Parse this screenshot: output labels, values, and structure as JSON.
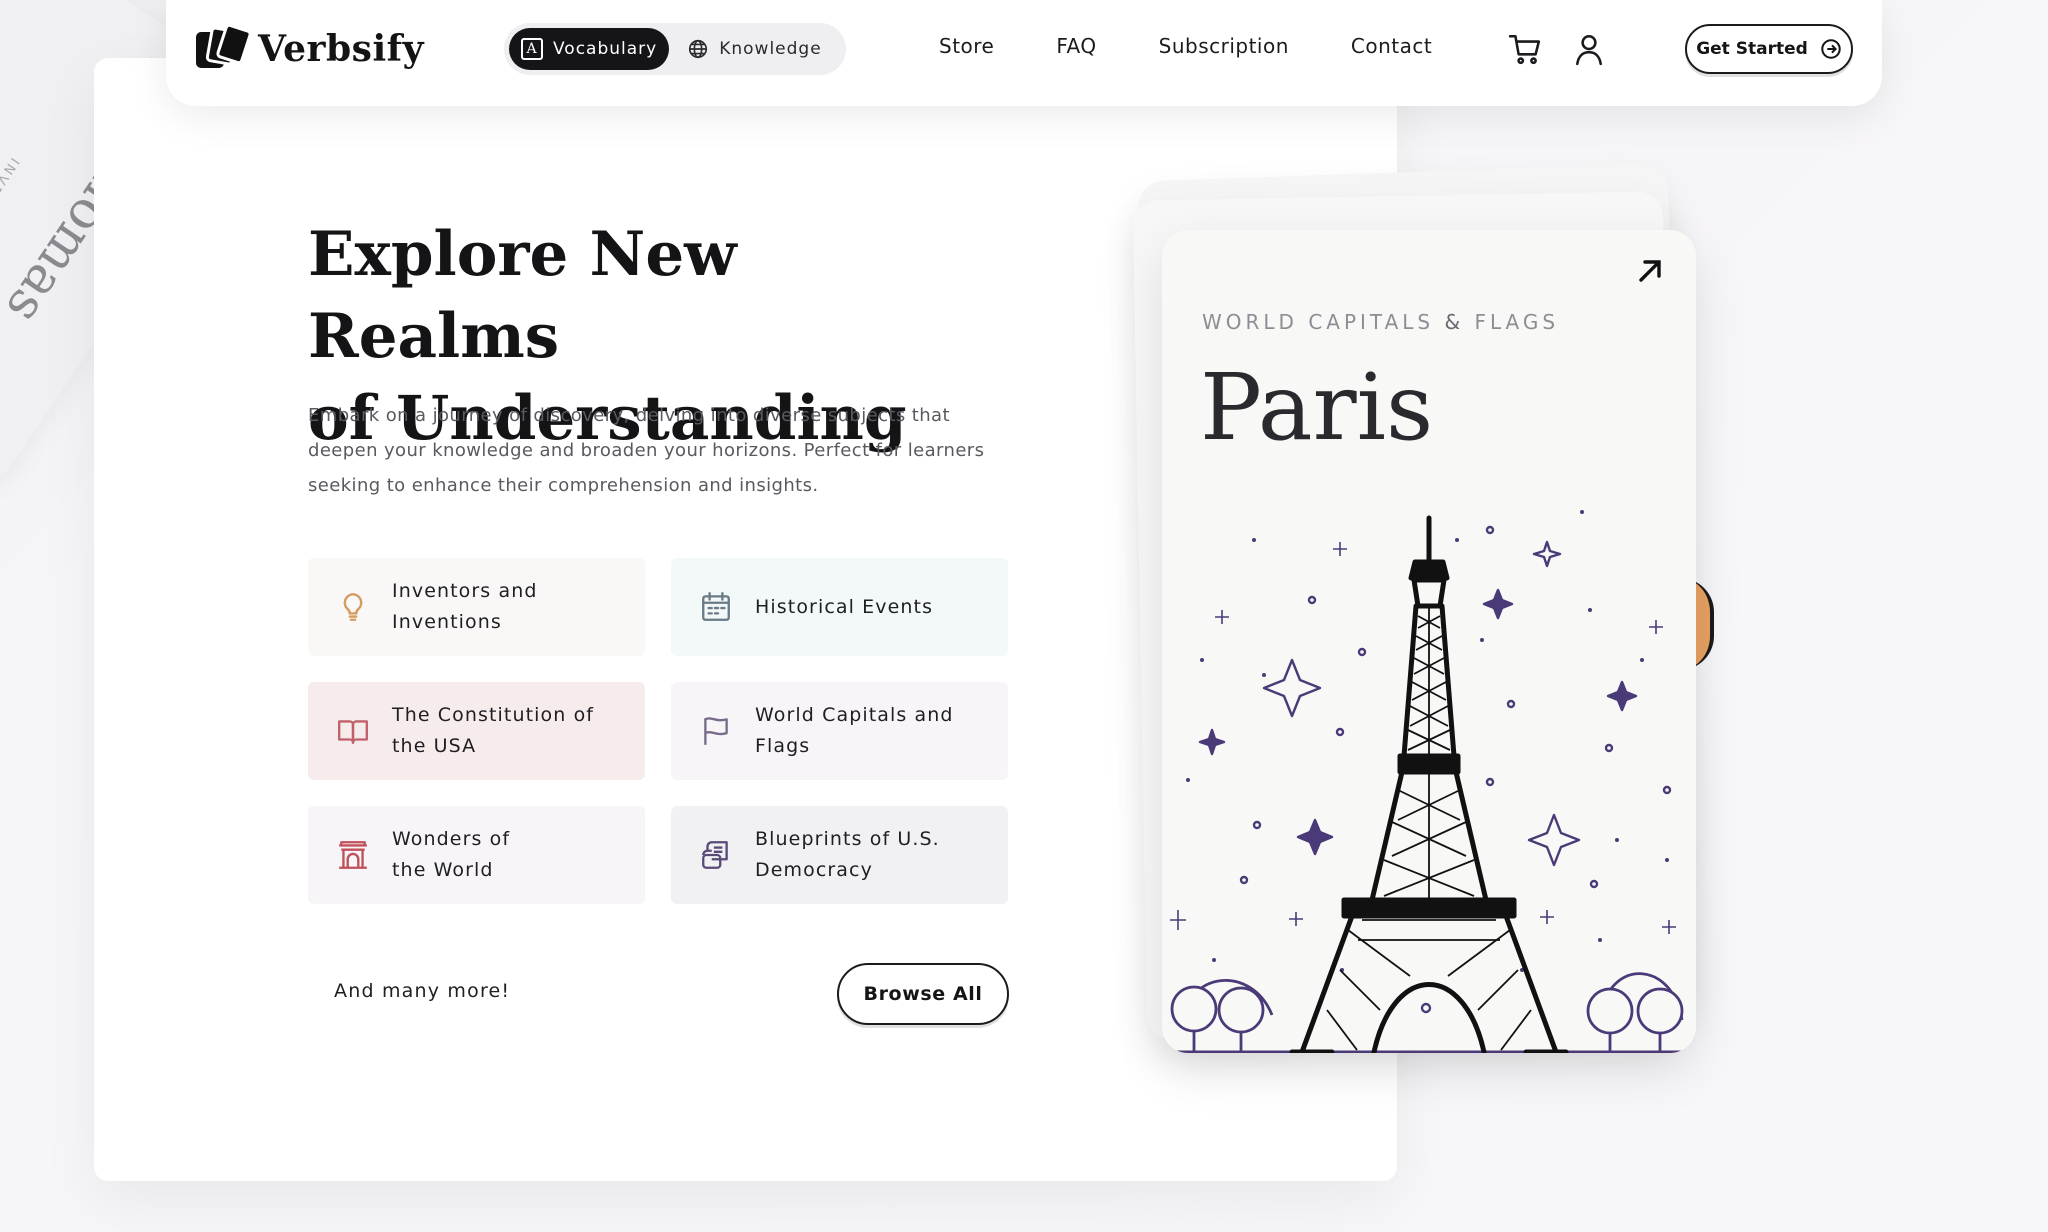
{
  "background_card": {
    "title": "Thomas",
    "subtitle": "INVENTOR"
  },
  "nav": {
    "brand": "Verbsify",
    "segments": [
      {
        "label": "Vocabulary",
        "icon": "letter-a-icon",
        "active": true
      },
      {
        "label": "Knowledge",
        "icon": "globe-icon",
        "active": false
      }
    ],
    "links": [
      "Store",
      "FAQ",
      "Subscription",
      "Contact"
    ],
    "cta": "Get Started"
  },
  "hero": {
    "title_line1": "Explore New Realms",
    "title_line2": "of Understanding",
    "subtitle": "Embark on a journey of discovery, delving into diverse subjects that deepen your knowledge and broaden your horizons. Perfect for learners seeking to enhance their comprehension and insights."
  },
  "categories": [
    {
      "label": "Inventors and Inventions",
      "icon": "lightbulb-icon",
      "color": "#d49a5e"
    },
    {
      "label": "Historical Events",
      "icon": "calendar-icon",
      "color": "#6a7a86"
    },
    {
      "label": "The Constitution of the USA",
      "icon": "book-icon",
      "color": "#c0606a"
    },
    {
      "label": "World Capitals and Flags",
      "icon": "flag-icon",
      "color": "#7a6a8a"
    },
    {
      "label": "Wonders of the World",
      "icon": "monument-icon",
      "color": "#c0505a"
    },
    {
      "label": "Blueprints of U.S. Democracy",
      "icon": "documents-icon",
      "color": "#5a4a7a"
    }
  ],
  "footer": {
    "more": "And many more!",
    "browse": "Browse All"
  },
  "card": {
    "kicker_a": "WORLD CAPITALS",
    "kicker_amp": "&",
    "kicker_b": "FLAGS",
    "city": "Paris",
    "illustration": "eiffel-tower-icon"
  },
  "colors": {
    "accent_dark": "#151417",
    "illustration_purple": "#4b3a78",
    "card_orange": "#e8a062"
  }
}
